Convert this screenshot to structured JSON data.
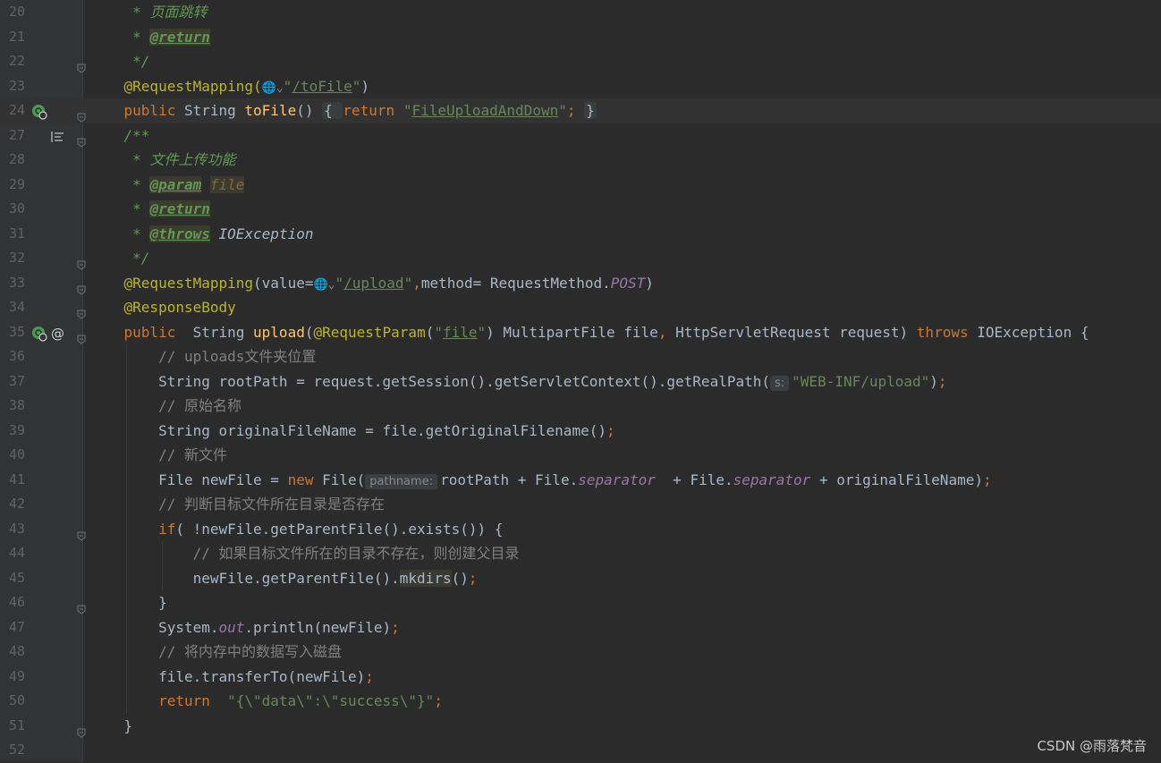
{
  "editor": {
    "lines": [
      {
        "n": "20",
        "segs": [
          {
            "t": "     * ",
            "c": "dc"
          },
          {
            "t": "页面跳转",
            "c": "dc"
          }
        ]
      },
      {
        "n": "21",
        "segs": [
          {
            "t": "     * ",
            "c": "dc"
          },
          {
            "t": "@return",
            "c": "dtag"
          }
        ]
      },
      {
        "n": "22",
        "segs": [
          {
            "t": "     */",
            "c": "dc"
          }
        ]
      },
      {
        "n": "23",
        "segs": [
          {
            "t": "    @RequestMapping(",
            "c": "a"
          },
          {
            "t": "🌐⌄",
            "c": "globe"
          },
          {
            "t": "\"",
            "c": "s"
          },
          {
            "t": "/toFile",
            "c": "su"
          },
          {
            "t": "\"",
            "c": "s"
          },
          {
            "t": ")",
            "c": ""
          }
        ]
      },
      {
        "n": "24",
        "caret": true,
        "segs": [
          {
            "t": "    public ",
            "c": "k"
          },
          {
            "t": "String ",
            "c": ""
          },
          {
            "t": "toFile",
            "c": "m"
          },
          {
            "t": "() ",
            "c": ""
          },
          {
            "t": "{ ",
            "c": "fold-box"
          },
          {
            "t": "return ",
            "c": "k"
          },
          {
            "t": "\"",
            "c": "s"
          },
          {
            "t": "FileUploadAndDown",
            "c": "su"
          },
          {
            "t": "\"",
            "c": "s"
          },
          {
            "t": "; ",
            "c": "k"
          },
          {
            "t": "}",
            "c": "fold-box"
          }
        ]
      },
      {
        "n": "27",
        "segs": [
          {
            "t": "    /**",
            "c": "dc"
          }
        ]
      },
      {
        "n": "28",
        "segs": [
          {
            "t": "     * ",
            "c": "dc"
          },
          {
            "t": "文件上传功能",
            "c": "dc"
          }
        ]
      },
      {
        "n": "29",
        "segs": [
          {
            "t": "     * ",
            "c": "dc"
          },
          {
            "t": "@param",
            "c": "dtag"
          },
          {
            "t": " ",
            "c": ""
          },
          {
            "t": "file",
            "c": "dparam"
          }
        ]
      },
      {
        "n": "30",
        "segs": [
          {
            "t": "     * ",
            "c": "dc"
          },
          {
            "t": "@return",
            "c": "dtag"
          }
        ]
      },
      {
        "n": "31",
        "segs": [
          {
            "t": "     * ",
            "c": "dc"
          },
          {
            "t": "@throws",
            "c": "dtag"
          },
          {
            "t": " IOException",
            "c": "dtx"
          }
        ]
      },
      {
        "n": "32",
        "segs": [
          {
            "t": "     */",
            "c": "dc"
          }
        ]
      },
      {
        "n": "33",
        "segs": [
          {
            "t": "    @RequestMapping",
            "c": "a"
          },
          {
            "t": "(value=",
            "c": ""
          },
          {
            "t": "🌐⌄",
            "c": "globe"
          },
          {
            "t": "\"",
            "c": "s"
          },
          {
            "t": "/upload",
            "c": "su"
          },
          {
            "t": "\"",
            "c": "s"
          },
          {
            "t": ",",
            "c": "k"
          },
          {
            "t": "method= RequestMethod.",
            "c": ""
          },
          {
            "t": "POST",
            "c": "f"
          },
          {
            "t": ")",
            "c": ""
          }
        ]
      },
      {
        "n": "34",
        "segs": [
          {
            "t": "    @ResponseBody",
            "c": "a"
          }
        ]
      },
      {
        "n": "35",
        "segs": [
          {
            "t": "    public  ",
            "c": "k"
          },
          {
            "t": "String ",
            "c": ""
          },
          {
            "t": "upload",
            "c": "m"
          },
          {
            "t": "(",
            "c": ""
          },
          {
            "t": "@RequestParam",
            "c": "a"
          },
          {
            "t": "(",
            "c": ""
          },
          {
            "t": "\"",
            "c": "s"
          },
          {
            "t": "file",
            "c": "su"
          },
          {
            "t": "\"",
            "c": "s"
          },
          {
            "t": ") MultipartFile file",
            "c": ""
          },
          {
            "t": ", ",
            "c": "k"
          },
          {
            "t": "HttpServletRequest request) ",
            "c": ""
          },
          {
            "t": "throws ",
            "c": "k"
          },
          {
            "t": "IOException {",
            "c": ""
          }
        ]
      },
      {
        "n": "36",
        "segs": [
          {
            "t": "        // uploads文件夹位置",
            "c": "c"
          }
        ]
      },
      {
        "n": "37",
        "segs": [
          {
            "t": "        String rootPath = request.getSession().getServletContext().getRealPath(",
            "c": ""
          },
          {
            "t": "s:",
            "c": "hint"
          },
          {
            "t": "\"WEB-INF/upload\"",
            "c": "s"
          },
          {
            "t": ")",
            "c": ""
          },
          {
            "t": ";",
            "c": "k"
          }
        ]
      },
      {
        "n": "38",
        "segs": [
          {
            "t": "        // 原始名称",
            "c": "c"
          }
        ]
      },
      {
        "n": "39",
        "segs": [
          {
            "t": "        String originalFileName = file.getOriginalFilename()",
            "c": ""
          },
          {
            "t": ";",
            "c": "k"
          }
        ]
      },
      {
        "n": "40",
        "segs": [
          {
            "t": "        // 新文件",
            "c": "c"
          }
        ]
      },
      {
        "n": "41",
        "segs": [
          {
            "t": "        File newFile = ",
            "c": ""
          },
          {
            "t": "new ",
            "c": "k"
          },
          {
            "t": "File(",
            "c": ""
          },
          {
            "t": "pathname:",
            "c": "hint"
          },
          {
            "t": "rootPath + File.",
            "c": ""
          },
          {
            "t": "separator",
            "c": "f"
          },
          {
            "t": "  + File.",
            "c": ""
          },
          {
            "t": "separator",
            "c": "f"
          },
          {
            "t": " + originalFileName)",
            "c": ""
          },
          {
            "t": ";",
            "c": "k"
          }
        ]
      },
      {
        "n": "42",
        "segs": [
          {
            "t": "        // 判断目标文件所在目录是否存在",
            "c": "c"
          }
        ]
      },
      {
        "n": "43",
        "segs": [
          {
            "t": "        if",
            "c": "k"
          },
          {
            "t": "( !newFile.getParentFile().exists()) {",
            "c": ""
          }
        ]
      },
      {
        "n": "44",
        "segs": [
          {
            "t": "            // 如果目标文件所在的目录不存在，则创建父目录",
            "c": "c"
          }
        ]
      },
      {
        "n": "45",
        "segs": [
          {
            "t": "            newFile.getParentFile().",
            "c": ""
          },
          {
            "t": "mkdirs",
            "c": "hl"
          },
          {
            "t": "()",
            "c": ""
          },
          {
            "t": ";",
            "c": "k"
          }
        ]
      },
      {
        "n": "46",
        "segs": [
          {
            "t": "        }",
            "c": ""
          }
        ]
      },
      {
        "n": "47",
        "segs": [
          {
            "t": "        System.",
            "c": ""
          },
          {
            "t": "out",
            "c": "f"
          },
          {
            "t": ".println(newFile)",
            "c": ""
          },
          {
            "t": ";",
            "c": "k"
          }
        ]
      },
      {
        "n": "48",
        "segs": [
          {
            "t": "        // 将内存中的数据写入磁盘",
            "c": "c"
          }
        ]
      },
      {
        "n": "49",
        "segs": [
          {
            "t": "        file.transferTo(newFile)",
            "c": ""
          },
          {
            "t": ";",
            "c": "k"
          }
        ]
      },
      {
        "n": "50",
        "segs": [
          {
            "t": "        return  ",
            "c": "k"
          },
          {
            "t": "\"{\\\"data\\\":\\\"success\\\"}\"",
            "c": "s"
          },
          {
            "t": ";",
            "c": "k"
          }
        ]
      },
      {
        "n": "51",
        "segs": [
          {
            "t": "    }",
            "c": ""
          }
        ]
      },
      {
        "n": "52",
        "segs": []
      }
    ]
  },
  "gutter_icons": {
    "24": [
      "web-endpoint-icon"
    ],
    "27": [
      "doc-comment-icon"
    ],
    "35": [
      "web-endpoint-icon",
      "annotation-at-icon"
    ]
  },
  "fold_lines": [
    "22",
    "24",
    "27",
    "32",
    "33",
    "34",
    "35",
    "43",
    "46",
    "51"
  ],
  "watermark": "CSDN @雨落梵音",
  "colors": {
    "background": "#2b2b2b",
    "keyword": "#cc7832",
    "annotation": "#bbb529",
    "string": "#6a8759",
    "method": "#ffc66d",
    "field": "#9876aa",
    "comment": "#808080",
    "doc": "#629755"
  }
}
